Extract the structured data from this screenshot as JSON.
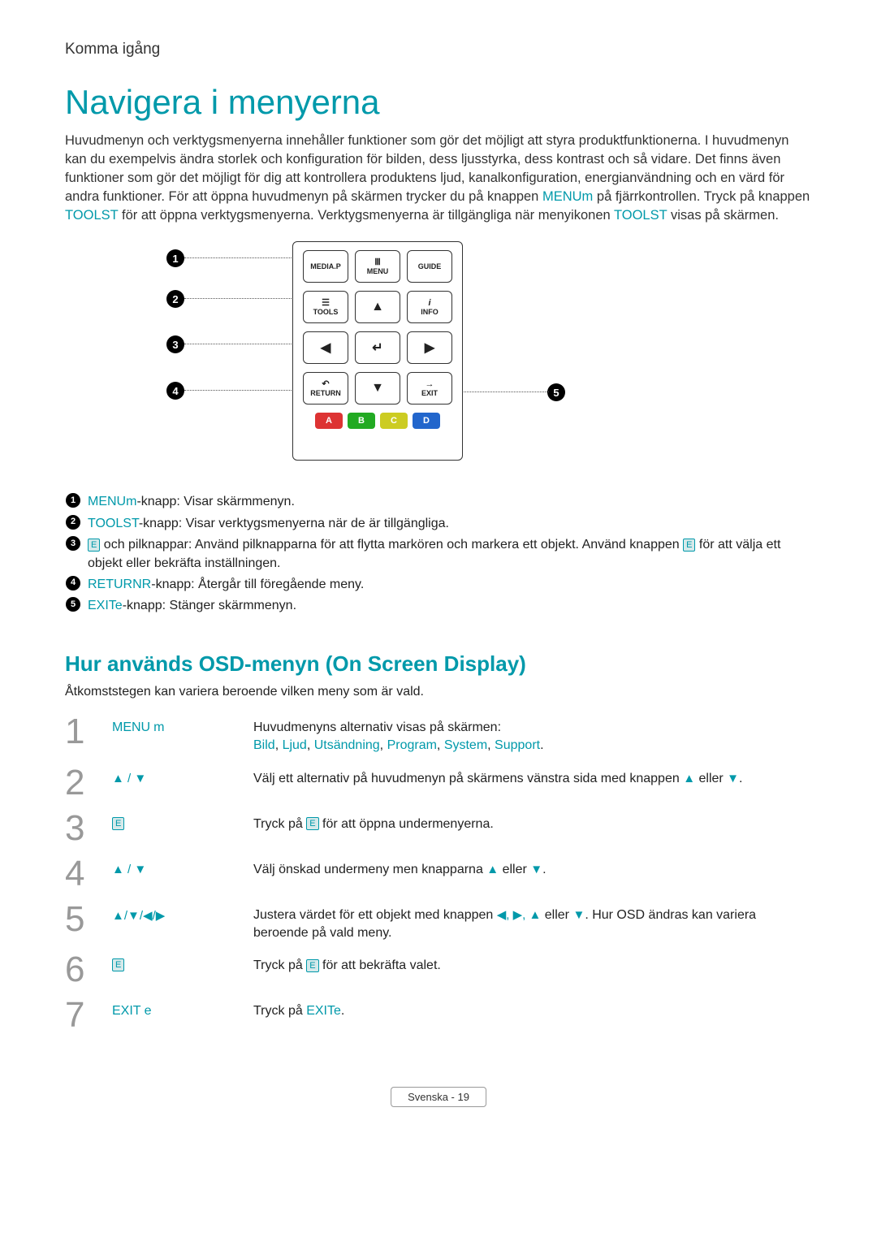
{
  "section_label": "Komma igång",
  "title": "Navigera i menyerna",
  "intro": {
    "p1": "Huvudmenyn och verktygsmenyerna innehåller funktioner som gör det möjligt att styra produktfunktionerna. I huvudmenyn kan du exempelvis ändra storlek och konfiguration för bilden, dess ljusstyrka, dess kontrast och så vidare. Det finns även funktioner som gör det möjligt för dig att kontrollera produktens ljud, kanalkonfiguration, energianvändning och en värd för andra funktioner. För att öppna huvudmenyn på skärmen trycker du på knappen ",
    "menu": "MENU",
    "p2": " på fjärrkontrollen. Tryck på knappen ",
    "tools": "TOOLS",
    "p3": " för att öppna verktygsmenyerna. Verktygsmenyerna är tillgängliga när menyikonen ",
    "tools2": "TOOLS",
    "p4": " visas på skärmen."
  },
  "remote": {
    "mediap": "MEDIA.P",
    "menu": "MENU",
    "guide": "GUIDE",
    "tools": "TOOLS",
    "info": "INFO",
    "return": "RETURN",
    "exit": "EXIT",
    "a": "A",
    "b": "B",
    "c": "C",
    "d": "D"
  },
  "callouts": {
    "1": "1",
    "2": "2",
    "3": "3",
    "4": "4",
    "5": "5"
  },
  "legend": {
    "l1_a": "MENU",
    "l1_b": "-knapp: Visar skärmmenyn.",
    "l2_a": "TOOLS",
    "l2_b": "-knapp: Visar verktygsmenyerna när de är tillgängliga.",
    "l3_a": "E",
    "l3_b": " och pilknappar: Använd pilknapparna för att flytta markören och markera ett objekt. Använd knappen ",
    "l3_c": "E",
    "l3_d": " för att välja ett objekt eller bekräfta inställningen.",
    "l4_a": "RETURN",
    "l4_b": "-knapp: Återgår till föregående meny.",
    "l5_a": "EXIT",
    "l5_b": "-knapp: Stänger skärmmenyn."
  },
  "subtitle": "Hur används OSD-menyn (On Screen Display)",
  "sub_intro": "Åtkomststegen kan variera beroende vilken meny som är vald.",
  "steps": [
    {
      "num": "1",
      "label": "MENU",
      "desc_a": "Huvudmenyns alternativ visas på skärmen:",
      "links": [
        "Bild",
        "Ljud",
        "Utsändning",
        "Program",
        "System",
        "Support"
      ]
    },
    {
      "num": "2",
      "label_arrows": "▲ / ▼",
      "desc_a": "Välj ett alternativ på huvudmenyn på skärmens vänstra sida med knappen ",
      "desc_b": "▲",
      "desc_c": " eller ",
      "desc_d": "▼",
      "desc_e": "."
    },
    {
      "num": "3",
      "label_icon": "E",
      "desc_a": "Tryck på ",
      "desc_b": "E",
      "desc_c": " för att öppna undermenyerna."
    },
    {
      "num": "4",
      "label_arrows": "▲ / ▼",
      "desc_a": "Välj önskad undermeny men knapparna ",
      "desc_b": "▲",
      "desc_c": " eller ",
      "desc_d": "▼",
      "desc_e": "."
    },
    {
      "num": "5",
      "label_arrows": "▲/▼/◀/▶",
      "desc_a": "Justera värdet för ett objekt med knappen ",
      "desc_b": "◀, ▶, ▲",
      "desc_c": " eller ",
      "desc_d": "▼",
      "desc_e": ". Hur OSD ändras kan variera beroende på vald meny."
    },
    {
      "num": "6",
      "label_icon": "E",
      "desc_a": "Tryck på ",
      "desc_b": "E",
      "desc_c": " för att bekräfta valet."
    },
    {
      "num": "7",
      "label": "EXIT",
      "desc_a": "Tryck på ",
      "desc_b": "EXIT",
      "desc_c": "."
    }
  ],
  "footer": "Svenska - 19"
}
